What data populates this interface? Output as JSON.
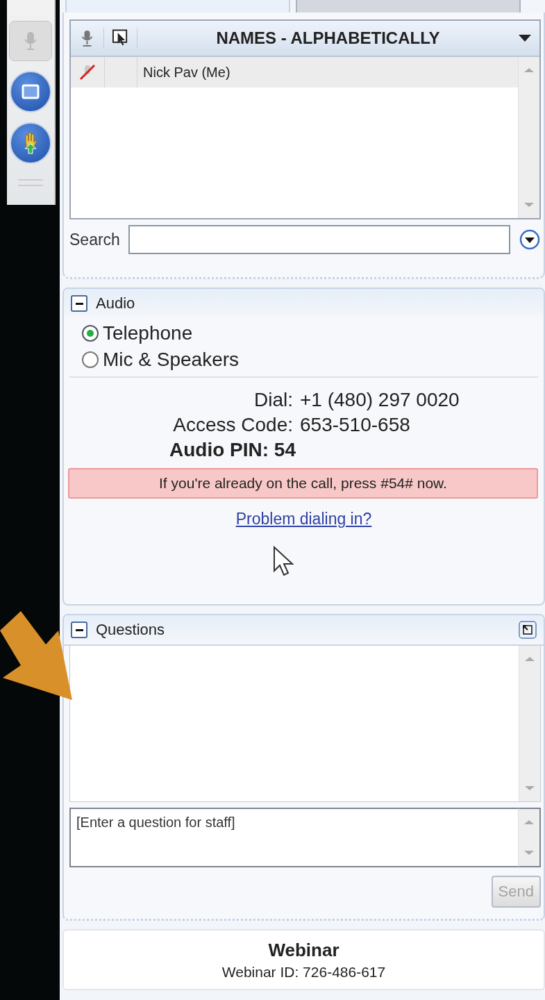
{
  "tabs": [
    {
      "selected": true
    },
    {
      "selected": false
    }
  ],
  "toolbar": [
    {
      "kind": "mic",
      "disabled": true
    },
    {
      "kind": "screen",
      "disabled": false
    },
    {
      "kind": "hand",
      "disabled": false
    }
  ],
  "attendees": {
    "header": "NAMES - ALPHABETICALLY",
    "rows": [
      {
        "name": "Nick Pav (Me)",
        "muted": true,
        "selected": true
      }
    ],
    "search_label": "Search"
  },
  "audio": {
    "title": "Audio",
    "options": [
      {
        "label": "Telephone",
        "selected": true
      },
      {
        "label": "Mic & Speakers",
        "selected": false
      }
    ],
    "details": [
      {
        "label": "Dial:",
        "value": "+1 (480) 297 0020"
      },
      {
        "label": "Access Code:",
        "value": "653-510-658"
      }
    ],
    "pin": "Audio PIN: 54",
    "notice": "If you're already on the call, press #54# now.",
    "link": "Problem dialing in?"
  },
  "questions": {
    "title": "Questions",
    "placeholder": "[Enter a question for staff]",
    "send": "Send",
    "send_disabled": true
  },
  "webinar": {
    "title": "Webinar",
    "id": "Webinar ID: 726-486-617"
  }
}
